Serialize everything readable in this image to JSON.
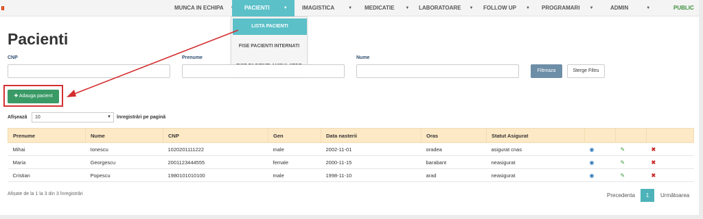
{
  "nav": {
    "items": [
      {
        "label": "MUNCA IN ECHIPA"
      },
      {
        "label": "PACIENTI"
      },
      {
        "label": "IMAGISTICA"
      },
      {
        "label": "MEDICATIE"
      },
      {
        "label": "LABORATOARE"
      },
      {
        "label": "FOLLOW UP"
      },
      {
        "label": "PROGRAMARI"
      },
      {
        "label": "ADMIN"
      }
    ],
    "public_label": "PUBLIC",
    "active": "PACIENTI",
    "active_color": "#5bc0c8"
  },
  "dropdown": {
    "items": [
      {
        "label": "LISTA PACIENTI"
      },
      {
        "label": "FISE PACIENTI INTERNATI"
      },
      {
        "label": "FISE PACIENTI AMBULATOR"
      }
    ]
  },
  "page": {
    "title": "Pacienti"
  },
  "filters": {
    "cnp_label": "CNP",
    "prenume_label": "Prenume",
    "nume_label": "Nume",
    "cnp_value": "",
    "prenume_value": "",
    "nume_value": "",
    "filter_button": "Filtreaza",
    "clear_button": "Sterge Filtru"
  },
  "actions": {
    "add_button": "Adauga pacient",
    "add_color": "#3a9a66"
  },
  "length": {
    "show_label": "Afișează",
    "selected": "10",
    "suffix": "înregistrări pe pagină"
  },
  "table": {
    "headers": [
      "Prenume",
      "Nume",
      "CNP",
      "Gen",
      "Data nasterii",
      "Oras",
      "Statut Asigurat"
    ],
    "rows": [
      [
        "Mihai",
        "Ionescu",
        "1020201111222",
        "male",
        "2002-11-01",
        "oradea",
        "asigurat cnas"
      ],
      [
        "Maria",
        "Georgescu",
        "2001123444555",
        "female",
        "2000-11-15",
        "barabant",
        "neasigurat"
      ],
      [
        "Cristian",
        "Popescu",
        "1980101010100",
        "male",
        "1998-11-10",
        "arad",
        "neasigurat"
      ]
    ],
    "header_color": "#fde9c5"
  },
  "footer": {
    "info": "Afișate de la 1 la 3 din 3 înregistrări",
    "prev": "Precedenta",
    "page": "1",
    "next": "Următoarea"
  },
  "icons": {
    "view": "eye-icon",
    "edit": "pencil-icon",
    "delete": "close-icon",
    "plus": "plus-icon"
  },
  "annotation_color": "#d32f2f"
}
